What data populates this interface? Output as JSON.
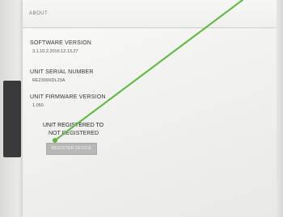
{
  "header": {
    "title": "ABOUT"
  },
  "software": {
    "label": "SOFTWARE VERSION",
    "value": "3.1.10.2.2016.12.13.27"
  },
  "serial": {
    "label": "UNIT SERIAL NUMBER",
    "value": "RE2309XDL23A"
  },
  "firmware": {
    "label": "UNIT FIRMWARE VERSION",
    "value": "1.050"
  },
  "registration": {
    "title": "UNIT REGISTERED TO",
    "status": "NOT REGISTERED",
    "button_label": "REGISTER DEVICE"
  },
  "colors": {
    "pointer_line": "#55bb33",
    "button": "#b8b8b8"
  }
}
